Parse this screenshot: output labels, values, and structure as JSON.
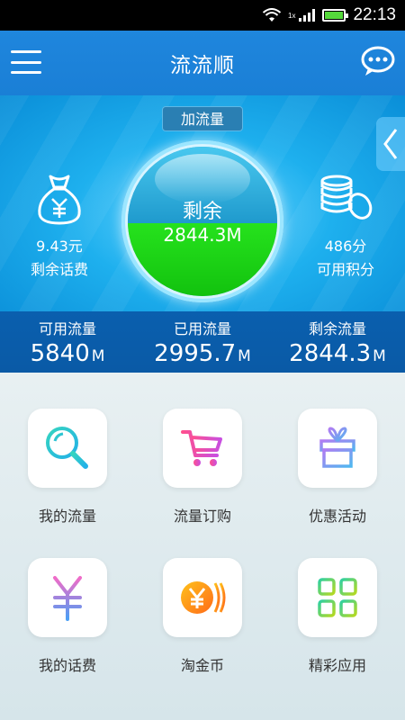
{
  "status_bar": {
    "time": "22:13",
    "network": "1x"
  },
  "header": {
    "title": "流流顺"
  },
  "hero": {
    "add_flow_label": "加流量",
    "ball_label": "剩余",
    "ball_value": "2844.3M",
    "remaining_fraction": 0.49,
    "left": {
      "value": "9.43元",
      "label": "剩余话费"
    },
    "right": {
      "value": "486分",
      "label": "可用积分"
    }
  },
  "stats": [
    {
      "label": "可用流量",
      "value": "5840",
      "unit": "M"
    },
    {
      "label": "已用流量",
      "value": "2995.7",
      "unit": "M"
    },
    {
      "label": "剩余流量",
      "value": "2844.3",
      "unit": "M"
    }
  ],
  "grid": [
    {
      "label": "我的流量",
      "icon": "magnifier-icon"
    },
    {
      "label": "流量订购",
      "icon": "cart-icon"
    },
    {
      "label": "优惠活动",
      "icon": "gift-icon"
    },
    {
      "label": "我的话费",
      "icon": "yen-icon"
    },
    {
      "label": "淘金币",
      "icon": "coin-icon"
    },
    {
      "label": "精彩应用",
      "icon": "apps-grid-icon"
    }
  ]
}
